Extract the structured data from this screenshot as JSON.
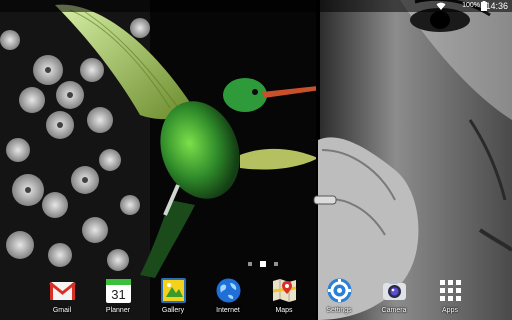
{
  "status_bar": {
    "time": "14:36",
    "battery_percent": "100%",
    "icons": [
      "wifi-icon",
      "battery-icon"
    ]
  },
  "home": {
    "page_indicator": {
      "pages": 3,
      "current": 2
    }
  },
  "dock": {
    "items": [
      {
        "label": "Gmail",
        "icon": "gmail-icon"
      },
      {
        "label": "Planner",
        "icon": "calendar-icon",
        "icon_text": "31"
      },
      {
        "label": "Gallery",
        "icon": "gallery-icon"
      },
      {
        "label": "Internet",
        "icon": "globe-icon"
      },
      {
        "label": "Maps",
        "icon": "maps-icon"
      },
      {
        "label": "Settings",
        "icon": "settings-icon"
      },
      {
        "label": "Camera",
        "icon": "camera-icon"
      },
      {
        "label": "Apps",
        "icon": "apps-grid-icon"
      }
    ]
  },
  "colors": {
    "accent_green": "#3cbf3c",
    "gmail_red": "#d93025",
    "globe_blue": "#1f6fd6",
    "settings_blue": "#2a7fd8"
  }
}
